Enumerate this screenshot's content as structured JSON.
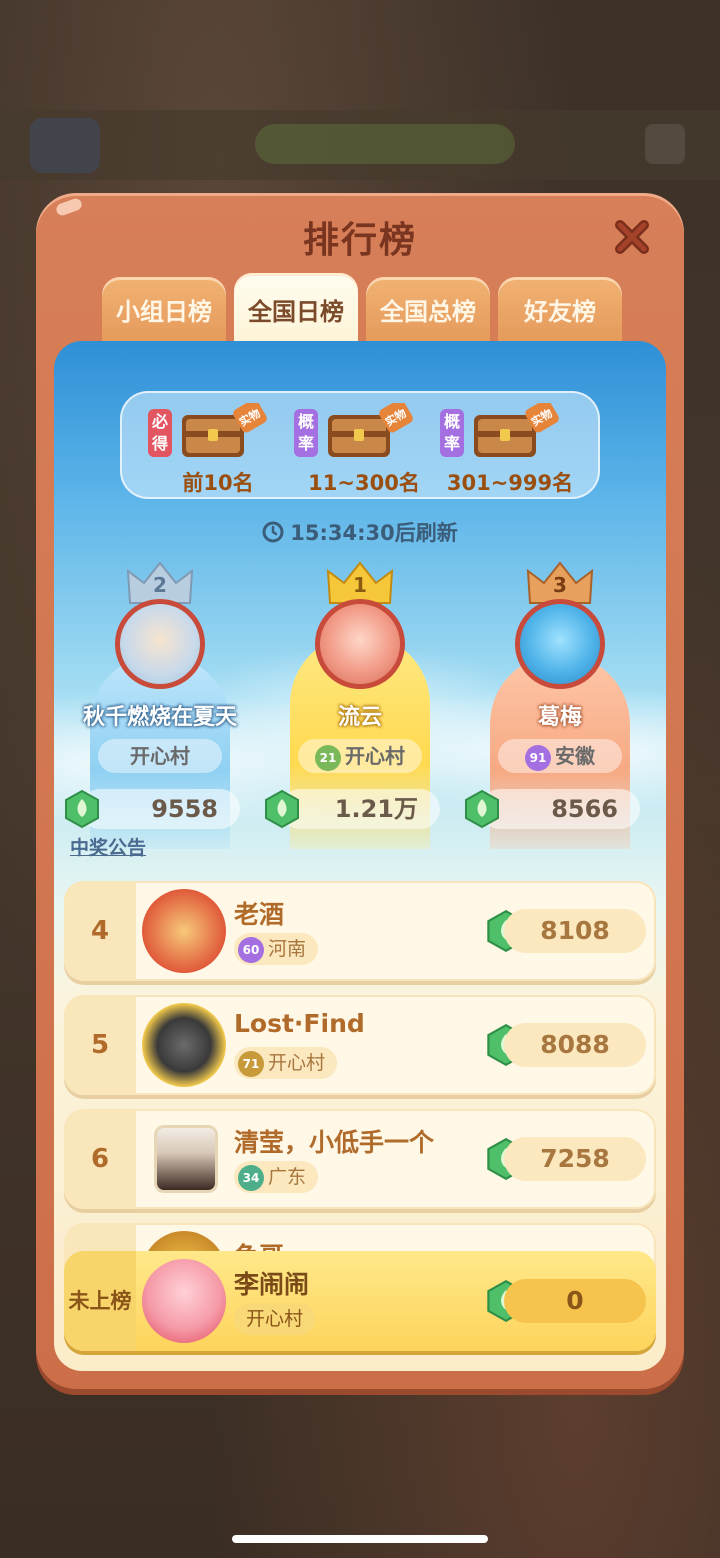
{
  "panel": {
    "title": "排行榜",
    "close_icon": "close-icon"
  },
  "tabs": [
    {
      "label": "小组日榜",
      "active": false
    },
    {
      "label": "全国日榜",
      "active": true
    },
    {
      "label": "全国总榜",
      "active": false
    },
    {
      "label": "好友榜",
      "active": false
    }
  ],
  "rewards": [
    {
      "tag": "必得",
      "label": "前10名",
      "chest_badge": "实物"
    },
    {
      "tag": "概率",
      "label": "11~300名",
      "chest_badge": "实物"
    },
    {
      "tag": "概率",
      "label": "301~999名",
      "chest_badge": "实物"
    }
  ],
  "timer": {
    "text": "15:34:30后刷新"
  },
  "podium": [
    {
      "rank": "2",
      "name": "秋千燃烧在夏天",
      "region": "开心村",
      "level": "",
      "score": "9558"
    },
    {
      "rank": "1",
      "name": "流云",
      "region": "开心村",
      "level": "21",
      "score": "1.21万"
    },
    {
      "rank": "3",
      "name": "葛梅",
      "region": "安徽",
      "level": "91",
      "score": "8566"
    }
  ],
  "notice": "中奖公告",
  "ranks": [
    {
      "rank": "4",
      "name": "老酒",
      "level": "60",
      "region": "河南",
      "score": "8108"
    },
    {
      "rank": "5",
      "name": "Lost·Find",
      "level": "71",
      "region": "开心村",
      "score": "8088"
    },
    {
      "rank": "6",
      "name": "清莹，小低手一个",
      "level": "34",
      "region": "广东",
      "score": "7258"
    },
    {
      "rank": "",
      "name": "鱼哥",
      "level": "",
      "region": "",
      "score": ""
    }
  ],
  "me": {
    "rank": "未上榜",
    "name": "李闹闹",
    "region": "开心村",
    "score": "0"
  },
  "colors": {
    "accent": "#cc6f49",
    "tab_active": "#fdf3d6",
    "gold": "#f2c94c"
  }
}
